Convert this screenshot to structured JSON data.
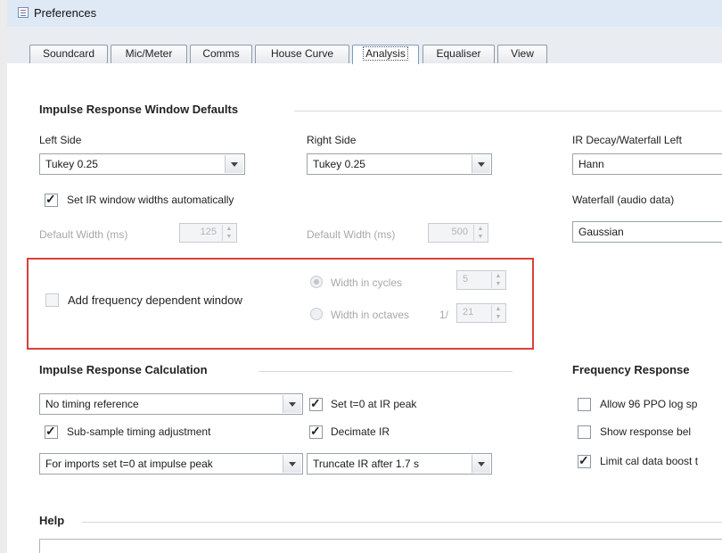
{
  "window": {
    "title": "Preferences"
  },
  "tabs": [
    "Soundcard",
    "Mic/Meter",
    "Comms",
    "House Curve",
    "Analysis",
    "Equaliser",
    "View"
  ],
  "active_tab": "Analysis",
  "window_defaults": {
    "title": "Impulse Response Window Defaults",
    "left_label": "Left Side",
    "left_value": "Tukey 0.25",
    "right_label": "Right Side",
    "right_value": "Tukey 0.25",
    "decay_label": "IR Decay/Waterfall Left",
    "decay_value": "Hann",
    "waterfall_label": "Waterfall (audio data)",
    "waterfall_value": "Gaussian",
    "auto_widths_label": "Set IR window widths automatically",
    "auto_widths_checked": true,
    "default_width_left_label": "Default Width (ms)",
    "default_width_left_value": "125",
    "default_width_right_label": "Default Width (ms)",
    "default_width_right_value": "500",
    "freq_dep_label": "Add frequency dependent window",
    "freq_dep_checked": false,
    "cycles_label": "Width in cycles",
    "cycles_value": "5",
    "octaves_label": "Width in octaves",
    "octaves_prefix": "1/",
    "octaves_value": "21"
  },
  "calculation": {
    "title": "Impulse Response Calculation",
    "timing_value": "No timing reference",
    "set_t0_label": "Set t=0 at IR peak",
    "set_t0_checked": true,
    "subsample_label": "Sub-sample timing adjustment",
    "subsample_checked": true,
    "decimate_label": "Decimate IR",
    "decimate_checked": true,
    "imports_value": "For imports set t=0 at impulse peak",
    "truncate_value": "Truncate IR after 1.7 s"
  },
  "frequency_response": {
    "title": "Frequency Response",
    "allow96_label": "Allow 96 PPO log sp",
    "allow96_checked": false,
    "show_below_label": "Show response bel",
    "show_below_checked": false,
    "limit_cal_label": "Limit cal data boost t",
    "limit_cal_checked": true
  },
  "help": {
    "title": "Help"
  },
  "colors": {
    "highlight_border": "#d9403c",
    "titlebar": "#dfe9f5"
  }
}
